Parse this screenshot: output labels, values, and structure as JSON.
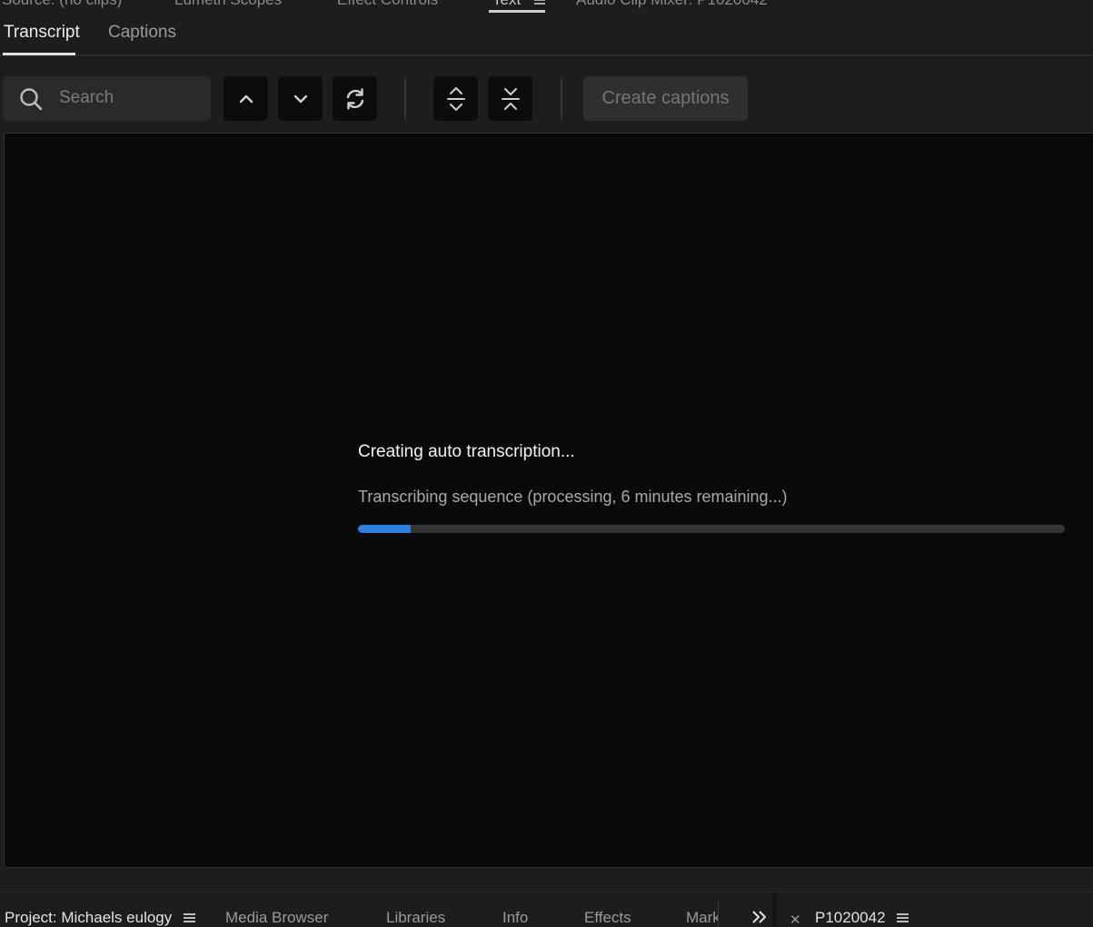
{
  "top_tabs": [
    {
      "label": "Source: (no clips)"
    },
    {
      "label": "Lumetri Scopes"
    },
    {
      "label": "Effect Controls"
    },
    {
      "label": "Text"
    },
    {
      "label": "Audio Clip Mixer: P1020042"
    }
  ],
  "sub_tabs": {
    "transcript": "Transcript",
    "captions": "Captions",
    "active": "Transcript"
  },
  "toolbar": {
    "search_placeholder": "Search",
    "icons": [
      "search-icon",
      "chevron-up-icon",
      "chevron-down-icon",
      "refresh-icon",
      "expand-icon",
      "collapse-icon"
    ],
    "create_captions_label": "Create captions"
  },
  "status": {
    "title": "Creating auto transcription...",
    "detail": "Transcribing sequence (processing, 6 minutes remaining...)",
    "progress_fraction": 0.075
  },
  "bottom_tabs": {
    "project": "Project: Michaels eulogy",
    "media_browser": "Media Browser",
    "libraries": "Libraries",
    "info": "Info",
    "effects": "Effects",
    "markers": "Markers",
    "sequence": "P1020042"
  },
  "colors": {
    "accent": "#2f7fe0",
    "panel_bg": "#1d1d1d",
    "content_bg": "#0a0a0a"
  }
}
